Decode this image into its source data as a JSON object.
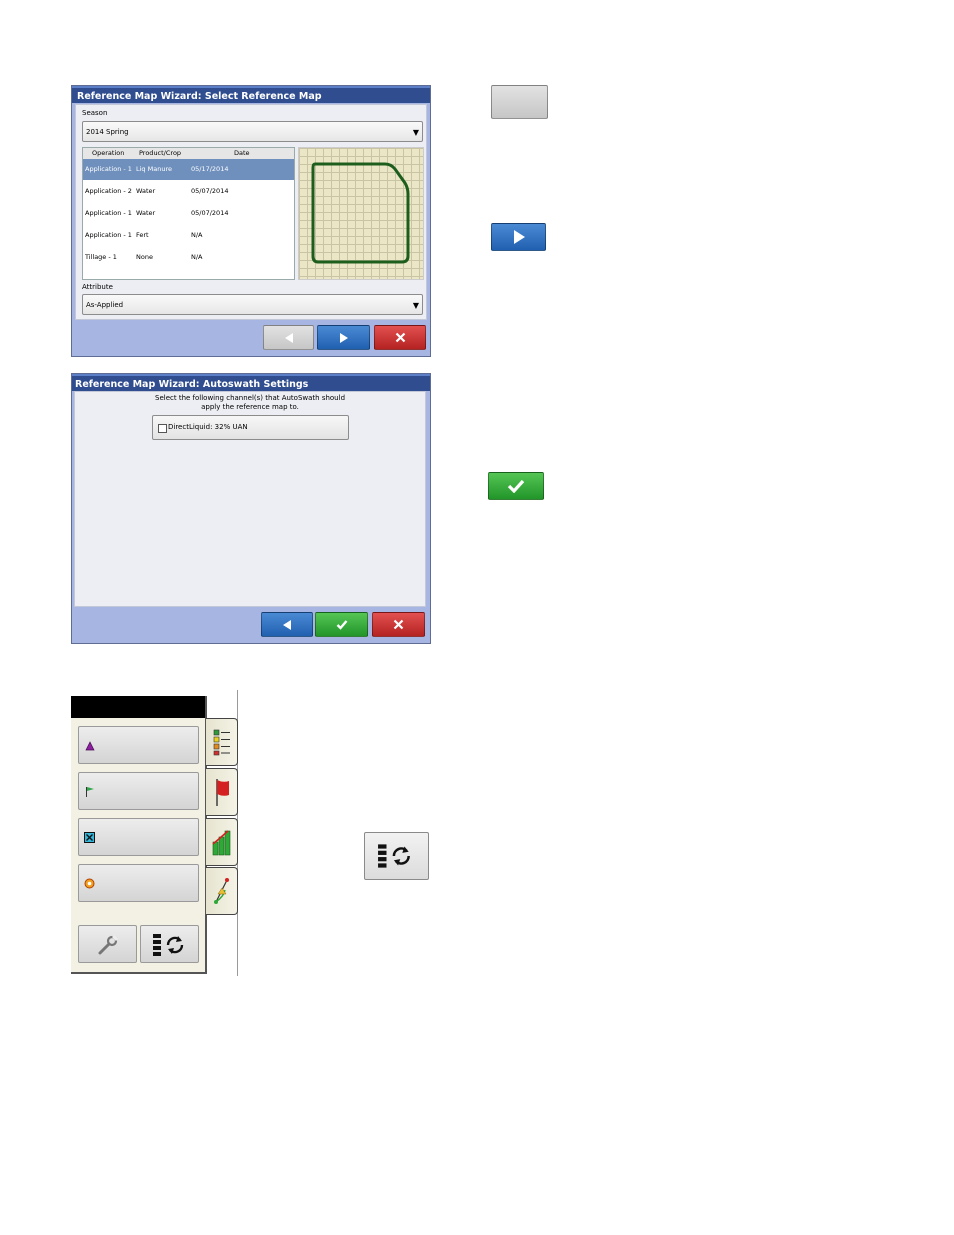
{
  "wizard1": {
    "title": "Reference Map Wizard: Select Reference Map",
    "season_label": "Season",
    "season_value": "2014 Spring",
    "columns": [
      "Operation",
      "Product/Crop",
      "Date"
    ],
    "rows": [
      {
        "operation": "Application - 1",
        "product": "Liq Manure",
        "date": "05/17/2014",
        "selected": true
      },
      {
        "operation": "Application - 2",
        "product": "Water",
        "date": "05/07/2014",
        "selected": false
      },
      {
        "operation": "Application - 1",
        "product": "Water",
        "date": "05/07/2014",
        "selected": false
      },
      {
        "operation": "Application - 1",
        "product": "Fert",
        "date": "N/A",
        "selected": false
      },
      {
        "operation": "Tillage - 1",
        "product": "None",
        "date": "N/A",
        "selected": false
      }
    ],
    "attribute_label": "Attribute",
    "attribute_value": "As-Applied"
  },
  "wizard2": {
    "title": "Reference Map Wizard: Autoswath Settings",
    "instruction": "Select the following channel(s) that AutoSwath should apply the reference map to.",
    "channel_label": "DirectLiquid: 32% UAN",
    "channel_checked": false
  },
  "icons": {
    "back": "back-arrow-icon",
    "next": "next-arrow-icon",
    "cancel": "close-icon",
    "accept": "checkmark-icon",
    "legend_tab": "legend-icon",
    "flag_tab": "flag-icon",
    "chart_tab": "bar-chart-icon",
    "guidance_tab": "guidance-icon",
    "wrench": "wrench-icon",
    "layers_refresh": "layers-refresh-icon"
  },
  "colors": {
    "title_bar": "#2f4d8f",
    "selected_row": "#6f90bd",
    "next_blue": "#2a6fc0",
    "accept_green": "#2ea836",
    "cancel_red": "#c63232"
  }
}
